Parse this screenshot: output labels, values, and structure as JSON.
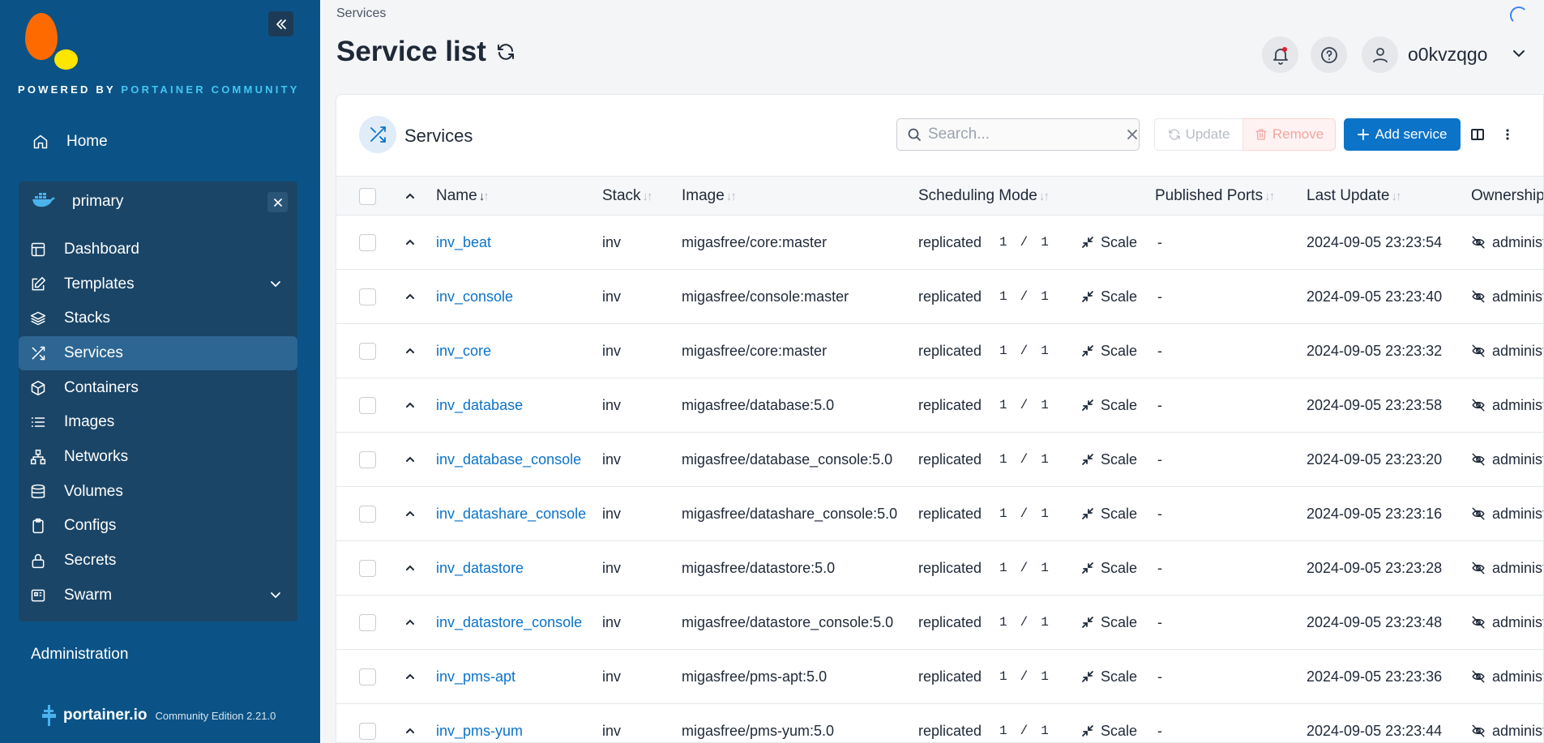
{
  "sidebar": {
    "powered_prefix": "POWERED BY",
    "powered_brand": "PORTAINER COMMUNITY",
    "home": "Home",
    "environment": "primary",
    "items": [
      {
        "label": "Dashboard",
        "icon": "dashboard-icon"
      },
      {
        "label": "Templates",
        "icon": "templates-icon"
      },
      {
        "label": "Stacks",
        "icon": "stacks-icon"
      },
      {
        "label": "Services",
        "icon": "services-icon"
      },
      {
        "label": "Containers",
        "icon": "containers-icon"
      },
      {
        "label": "Images",
        "icon": "images-icon"
      },
      {
        "label": "Networks",
        "icon": "networks-icon"
      },
      {
        "label": "Volumes",
        "icon": "volumes-icon"
      },
      {
        "label": "Configs",
        "icon": "configs-icon"
      },
      {
        "label": "Secrets",
        "icon": "secrets-icon"
      },
      {
        "label": "Swarm",
        "icon": "swarm-icon"
      }
    ],
    "administration": "Administration",
    "footer_brand": "portainer.io",
    "footer_edition": "Community Edition 2.21.0"
  },
  "header": {
    "breadcrumb": "Services",
    "title": "Service list",
    "username": "o0kvzqgo"
  },
  "card": {
    "title": "Services",
    "search_placeholder": "Search...",
    "update_label": "Update",
    "remove_label": "Remove",
    "add_label": "Add service"
  },
  "table": {
    "columns": [
      "Name",
      "Stack",
      "Image",
      "Scheduling Mode",
      "Published Ports",
      "Last Update",
      "Ownership"
    ],
    "rows": [
      {
        "name": "inv_beat",
        "stack": "inv",
        "image": "migasfree/core:master",
        "mode": "replicated",
        "running": "1",
        "desired": "1",
        "scale": "Scale",
        "ports": "-",
        "updated": "2024-09-05 23:23:54",
        "owner": "administrators"
      },
      {
        "name": "inv_console",
        "stack": "inv",
        "image": "migasfree/console:master",
        "mode": "replicated",
        "running": "1",
        "desired": "1",
        "scale": "Scale",
        "ports": "-",
        "updated": "2024-09-05 23:23:40",
        "owner": "administrators"
      },
      {
        "name": "inv_core",
        "stack": "inv",
        "image": "migasfree/core:master",
        "mode": "replicated",
        "running": "1",
        "desired": "1",
        "scale": "Scale",
        "ports": "-",
        "updated": "2024-09-05 23:23:32",
        "owner": "administrators"
      },
      {
        "name": "inv_database",
        "stack": "inv",
        "image": "migasfree/database:5.0",
        "mode": "replicated",
        "running": "1",
        "desired": "1",
        "scale": "Scale",
        "ports": "-",
        "updated": "2024-09-05 23:23:58",
        "owner": "administrators"
      },
      {
        "name": "inv_database_console",
        "stack": "inv",
        "image": "migasfree/database_console:5.0",
        "mode": "replicated",
        "running": "1",
        "desired": "1",
        "scale": "Scale",
        "ports": "-",
        "updated": "2024-09-05 23:23:20",
        "owner": "administrators"
      },
      {
        "name": "inv_datashare_console",
        "stack": "inv",
        "image": "migasfree/datashare_console:5.0",
        "mode": "replicated",
        "running": "1",
        "desired": "1",
        "scale": "Scale",
        "ports": "-",
        "updated": "2024-09-05 23:23:16",
        "owner": "administrators"
      },
      {
        "name": "inv_datastore",
        "stack": "inv",
        "image": "migasfree/datastore:5.0",
        "mode": "replicated",
        "running": "1",
        "desired": "1",
        "scale": "Scale",
        "ports": "-",
        "updated": "2024-09-05 23:23:28",
        "owner": "administrators"
      },
      {
        "name": "inv_datastore_console",
        "stack": "inv",
        "image": "migasfree/datastore_console:5.0",
        "mode": "replicated",
        "running": "1",
        "desired": "1",
        "scale": "Scale",
        "ports": "-",
        "updated": "2024-09-05 23:23:48",
        "owner": "administrators"
      },
      {
        "name": "inv_pms-apt",
        "stack": "inv",
        "image": "migasfree/pms-apt:5.0",
        "mode": "replicated",
        "running": "1",
        "desired": "1",
        "scale": "Scale",
        "ports": "-",
        "updated": "2024-09-05 23:23:36",
        "owner": "administrators"
      },
      {
        "name": "inv_pms-yum",
        "stack": "inv",
        "image": "migasfree/pms-yum:5.0",
        "mode": "replicated",
        "running": "1",
        "desired": "1",
        "scale": "Scale",
        "ports": "-",
        "updated": "2024-09-05 23:23:44",
        "owner": "administrators"
      }
    ]
  },
  "colors": {
    "sidebar_bg": "#0b5386",
    "accent": "#0b73c8",
    "brand_orange": "#ff6a00",
    "brand_yellow": "#ffe600"
  }
}
